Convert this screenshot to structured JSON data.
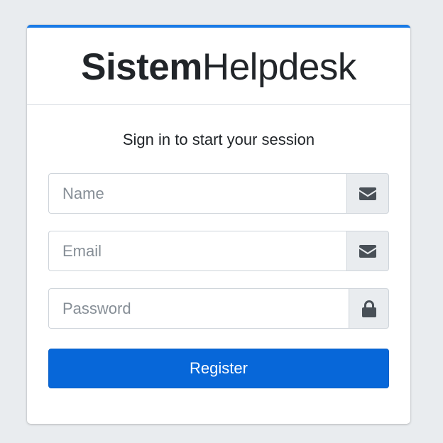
{
  "brand": {
    "bold": "Sistem",
    "light": "Helpdesk"
  },
  "login_message": "Sign in to start your session",
  "fields": {
    "name": {
      "placeholder": "Name",
      "icon": "envelope-icon"
    },
    "email": {
      "placeholder": "Email",
      "icon": "envelope-icon"
    },
    "password": {
      "placeholder": "Password",
      "icon": "lock-icon"
    }
  },
  "register_button": {
    "label": "Register"
  },
  "colors": {
    "accent": "#1a7be6",
    "button": "#0767d9",
    "background": "#e9ecef",
    "icon": "#495057"
  }
}
